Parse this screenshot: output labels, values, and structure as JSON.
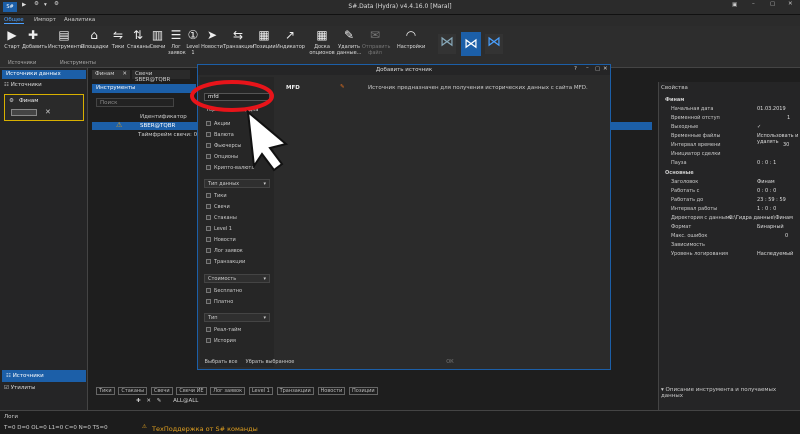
{
  "app": {
    "title": "S#.Data (Hydra) v4.4.16.0 [Maral]"
  },
  "menu": [
    "Общее",
    "Импорт",
    "Аналитика"
  ],
  "ribbon": {
    "buttons": [
      "Старт",
      "Добавить",
      "Инструменты",
      "Площадки",
      "Тики",
      "Стаканы",
      "Свечи",
      "Лог заявок",
      "Level 1",
      "Новости",
      "Транзакции",
      "Позиции",
      "Индикатор",
      "Доска опционов",
      "Удалить данные...",
      "Отправить файл",
      "Настройки"
    ],
    "groups": [
      "Источники",
      "Инструменты"
    ]
  },
  "left": {
    "header": "Источники данных",
    "sources_label": "Источники",
    "source_item": "Финам",
    "bottom_active": "Источники",
    "bottom_utils": "Утилиты"
  },
  "workspace": {
    "tabs": [
      "Финам",
      "Свечи SBER@TQBR"
    ],
    "instruments_header": "Инструменты",
    "search_placeholder": "Поиск",
    "col_id": "Идентификатор",
    "row_id": "SBER@TQBR",
    "row_tf": "Таймфрейм свечи: 00:01"
  },
  "properties": {
    "header": "Свойства",
    "groups": [
      "Финам",
      "Основные"
    ],
    "rows": [
      {
        "k": "Начальная дата",
        "v": "01.03.2019"
      },
      {
        "k": "Временной отступ",
        "v": "1"
      },
      {
        "k": "Выходные",
        "v": "✓"
      },
      {
        "k": "Временные файлы",
        "v": "Использовать и удалять"
      },
      {
        "k": "Интервал времени",
        "v": "30"
      },
      {
        "k": "Инициатор сделки",
        "v": ""
      },
      {
        "k": "Пауза",
        "v": "0 : 0 : 1"
      },
      {
        "k": "Заголовок",
        "v": "Финам"
      },
      {
        "k": "Работать с",
        "v": "0 : 0 : 0"
      },
      {
        "k": "Работать до",
        "v": "23 : 59 : 59"
      },
      {
        "k": "Интервал работы",
        "v": "1 : 0 : 0"
      },
      {
        "k": "Директория с данными",
        "v": "C:\\Гидра данные\\Финам"
      },
      {
        "k": "Формат",
        "v": "Бинарный"
      },
      {
        "k": "Макс. ошибок",
        "v": "0"
      },
      {
        "k": "Зависимость",
        "v": ""
      },
      {
        "k": "Уровень логирования",
        "v": "Наследуемый"
      }
    ],
    "footer": "Описание инструмента и получаемых данных"
  },
  "dialog": {
    "title": "Добавить источник",
    "search_value": "mfd",
    "platform_label": "Торговая площадка",
    "types": [
      "Акции",
      "Валюта",
      "Фьючерсы",
      "Опционы",
      "Крипто-валюта"
    ],
    "data_type_header": "Тип данных",
    "data_types": [
      "Тики",
      "Свечи",
      "Стаканы",
      "Level 1",
      "Новости",
      "Лог заявок",
      "Транзакции"
    ],
    "cost_header": "Стоимость",
    "costs": [
      "Бесплатно",
      "Платно"
    ],
    "kind_header": "Тип",
    "kinds": [
      "Реал-тайм",
      "История"
    ],
    "result_name": "MFD",
    "result_desc": "Источник предназначен для получения исторических данных с сайта MFD.",
    "select_all": "Выбрать все",
    "deselect": "Убрать выбранное",
    "ok": "ОК"
  },
  "bottombar": {
    "row1": [
      "Тики",
      "Стаканы",
      "Свечи",
      "Лог заявок",
      "Level 1",
      "Транзакции",
      "Новости",
      "Позиции"
    ],
    "candles_value": "Свечи ИЕ",
    "all": "ALL@ALL"
  },
  "status": {
    "log_label": "Логи",
    "counters": "T=0  D=0  OL=0  L1=0  C=0  N=0  T5=0",
    "support": "ТехПоддержка от S# команды"
  },
  "colors": {
    "accent": "#1c5fa8",
    "highlight_ring": "#e8141a",
    "warning": "#e0a020"
  }
}
